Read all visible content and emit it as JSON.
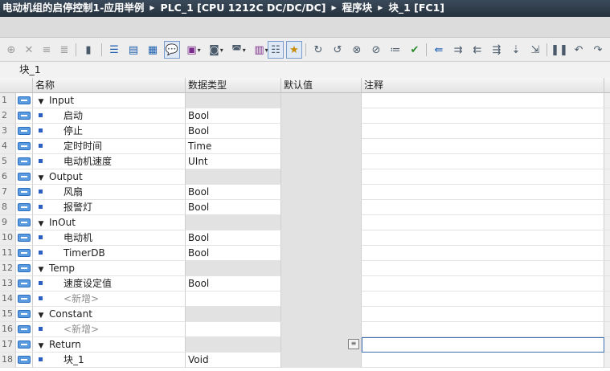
{
  "breadcrumb": [
    "电动机组的启停控制1-应用举例",
    "PLC_1 [CPU 1212C DC/DC/DC]",
    "程序块",
    "块_1 [FC1]"
  ],
  "block_name": "块_1",
  "columns": {
    "name": "名称",
    "type": "数据类型",
    "default": "默认值",
    "comment": "注释"
  },
  "rows": [
    {
      "num": "1",
      "kind": "section",
      "name": "Input",
      "type": ""
    },
    {
      "num": "2",
      "kind": "var",
      "name": "启动",
      "type": "Bool"
    },
    {
      "num": "3",
      "kind": "var",
      "name": "停止",
      "type": "Bool"
    },
    {
      "num": "4",
      "kind": "var",
      "name": "定时时间",
      "type": "Time"
    },
    {
      "num": "5",
      "kind": "var",
      "name": "电动机速度",
      "type": "UInt"
    },
    {
      "num": "6",
      "kind": "section",
      "name": "Output",
      "type": ""
    },
    {
      "num": "7",
      "kind": "var",
      "name": "风扇",
      "type": "Bool"
    },
    {
      "num": "8",
      "kind": "var",
      "name": "报警灯",
      "type": "Bool"
    },
    {
      "num": "9",
      "kind": "section",
      "name": "InOut",
      "type": ""
    },
    {
      "num": "10",
      "kind": "var",
      "name": "电动机",
      "type": "Bool"
    },
    {
      "num": "11",
      "kind": "var",
      "name": "TimerDB",
      "type": "Bool"
    },
    {
      "num": "12",
      "kind": "section",
      "name": "Temp",
      "type": ""
    },
    {
      "num": "13",
      "kind": "var",
      "name": "速度设定值",
      "type": "Bool"
    },
    {
      "num": "14",
      "kind": "new",
      "name": "<新增>",
      "type": ""
    },
    {
      "num": "15",
      "kind": "section",
      "name": "Constant",
      "type": ""
    },
    {
      "num": "16",
      "kind": "new",
      "name": "<新增>",
      "type": ""
    },
    {
      "num": "17",
      "kind": "section",
      "name": "Return",
      "type": "",
      "selected": true
    },
    {
      "num": "18",
      "kind": "var",
      "name": "块_1",
      "type": "Void"
    }
  ],
  "toolbar_icons": [
    "insert-network-icon",
    "delete-network-icon",
    "insert-row-icon",
    "add-row-icon",
    "open-all-icon",
    "close-all-icon",
    "absolute-operands-icon",
    "favorites-icon",
    "comments-toggle-icon",
    "network-comments-icon",
    "display-format-icon",
    "symbol-info-icon",
    "overview-icon",
    "favorites-bar-icon",
    "go-to-previous-error-icon",
    "go-to-next-error-icon",
    "update-calls-icon",
    "compare-icon",
    "check-icon",
    "monitor-on-off-icon",
    "insert-call-icon",
    "step-into-icon",
    "step-out-icon",
    "test-mode-icon",
    "breakpoint-icon",
    "continue-icon",
    "step-over-icon",
    "step-back-icon"
  ]
}
